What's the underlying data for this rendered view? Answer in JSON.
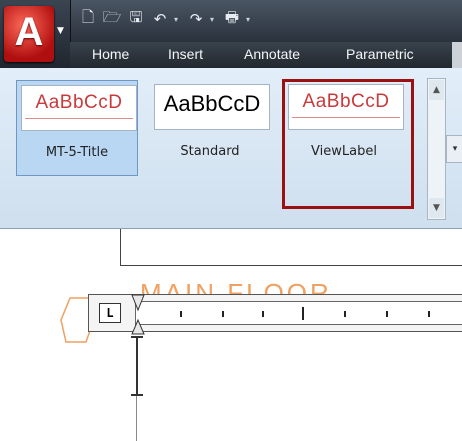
{
  "app": {
    "logo_letter": "A"
  },
  "quick_access": {
    "icons": [
      "new-file-icon",
      "open-folder-icon",
      "save-icon",
      "undo-icon",
      "redo-icon",
      "plot-icon",
      "customize-icon"
    ]
  },
  "tabs": [
    "Home",
    "Insert",
    "Annotate",
    "Parametric"
  ],
  "text_styles": [
    {
      "sample": "AaBbCcD",
      "label": "MT-5-Title",
      "selected": true
    },
    {
      "sample": "AaBbCcD",
      "label": "Standard",
      "selected": false
    },
    {
      "sample": "AaBbCcD",
      "label": "ViewLabel",
      "selected": false,
      "highlighted": true
    }
  ],
  "drawing": {
    "orange_text": "MAIN FLOOR"
  },
  "ruler": {
    "tab_marker": "L"
  },
  "colors": {
    "highlight_border": "#9b1111",
    "selected_fill": "#b9d6f2",
    "sample_red": "#c93a3a",
    "drawing_orange": "#f0a060"
  }
}
